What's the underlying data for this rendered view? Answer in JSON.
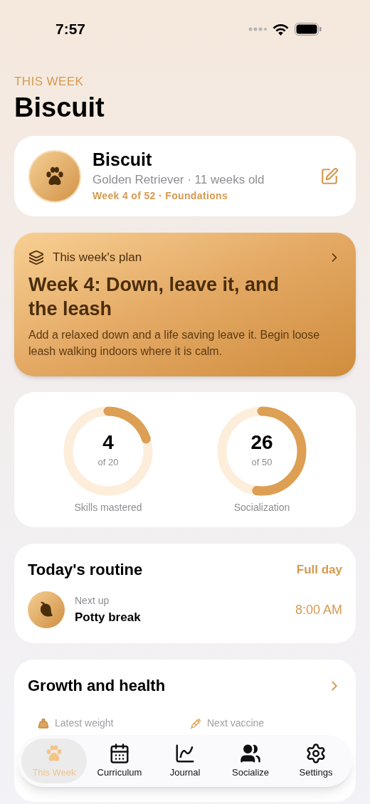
{
  "status_bar": {
    "time": "7:57"
  },
  "header": {
    "eyebrow": "THIS WEEK",
    "title": "Biscuit"
  },
  "profile": {
    "name": "Biscuit",
    "details": "Golden Retriever · 11 weeks old",
    "progress": "Week 4 of 52 · Foundations"
  },
  "plan": {
    "label": "This week's plan",
    "title": "Week 4: Down, leave it, and the leash",
    "description": "Add a relaxed down and a life saving leave it. Begin loose leash walking indoors where it is calm."
  },
  "stats": [
    {
      "value": "4",
      "total": "of 20",
      "label": "Skills mastered",
      "level": 0.2
    },
    {
      "value": "26",
      "total": "of 50",
      "label": "Socialization",
      "level": 0.52
    }
  ],
  "routine": {
    "title": "Today's routine",
    "action": "Full day",
    "next_label": "Next up",
    "next_item": "Potty break",
    "time": "8:00 AM"
  },
  "growth": {
    "title": "Growth and health",
    "items": [
      {
        "kind": "weight",
        "label": "Latest weight"
      },
      {
        "kind": "vaccine",
        "label": "Next vaccine"
      }
    ]
  },
  "tab_bar": [
    {
      "kind": "paw",
      "label": "This Week",
      "selected": true
    },
    {
      "kind": "calendar",
      "label": "Curriculum",
      "selected": false
    },
    {
      "kind": "chart",
      "label": "Journal",
      "selected": false
    },
    {
      "kind": "people",
      "label": "Socialize",
      "selected": false
    },
    {
      "kind": "gear",
      "label": "Settings",
      "selected": false
    }
  ]
}
